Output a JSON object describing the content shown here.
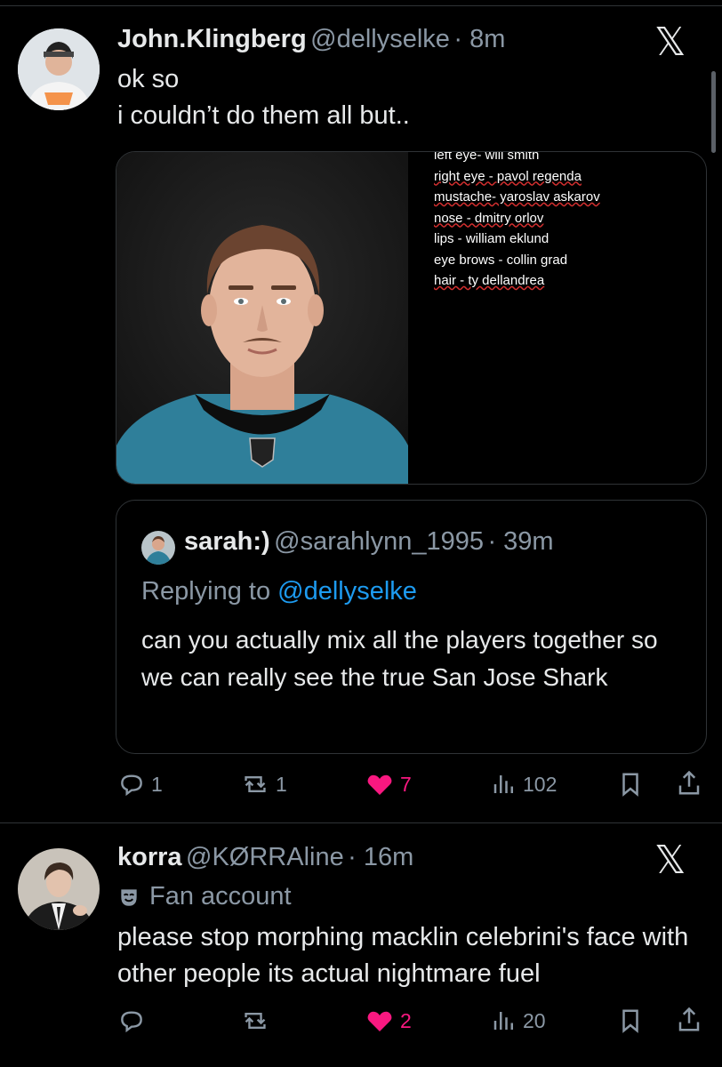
{
  "post1": {
    "name": "John.Klingberg",
    "handle": "@dellyselke",
    "time": "· 8m",
    "text_line1": "ok so",
    "text_line2": "i couldn’t do them all but..",
    "media_notes": [
      "left eye- will smith",
      "right eye - pavol regenda",
      "mustache- yaroslav askarov",
      "nose - dmitry orlov",
      "lips - william eklund",
      "eye brows - collin grad",
      "hair - ty dellandrea"
    ],
    "quote": {
      "name": "sarah:)",
      "handle": "@sarahlynn_1995",
      "time": "· 39m",
      "replying_prefix": "Replying to",
      "replying_handle": "@dellyselke",
      "text": "can you actually mix all the players together so we can really see the true San Jose Shark"
    },
    "actions": {
      "replies": "1",
      "reposts": "1",
      "likes": "7",
      "views": "102"
    }
  },
  "post2": {
    "name": "korra",
    "handle": "@KØRRAline",
    "time": "· 16m",
    "badge": "Fan account",
    "text": "please stop morphing macklin celebrini's face with other people its actual nightmare fuel",
    "actions": {
      "replies": "",
      "reposts": "",
      "likes": "2",
      "views": "20"
    }
  },
  "colors": {
    "background": "#000000",
    "text": "#e7e9ea",
    "muted": "#8b98a5",
    "link": "#1d9bf0",
    "like": "#f91880",
    "border": "#2f3336"
  },
  "icons": [
    "x-logo-icon",
    "reply-icon",
    "repost-icon",
    "heart-icon",
    "views-icon",
    "bookmark-icon",
    "share-icon",
    "mask-icon"
  ]
}
